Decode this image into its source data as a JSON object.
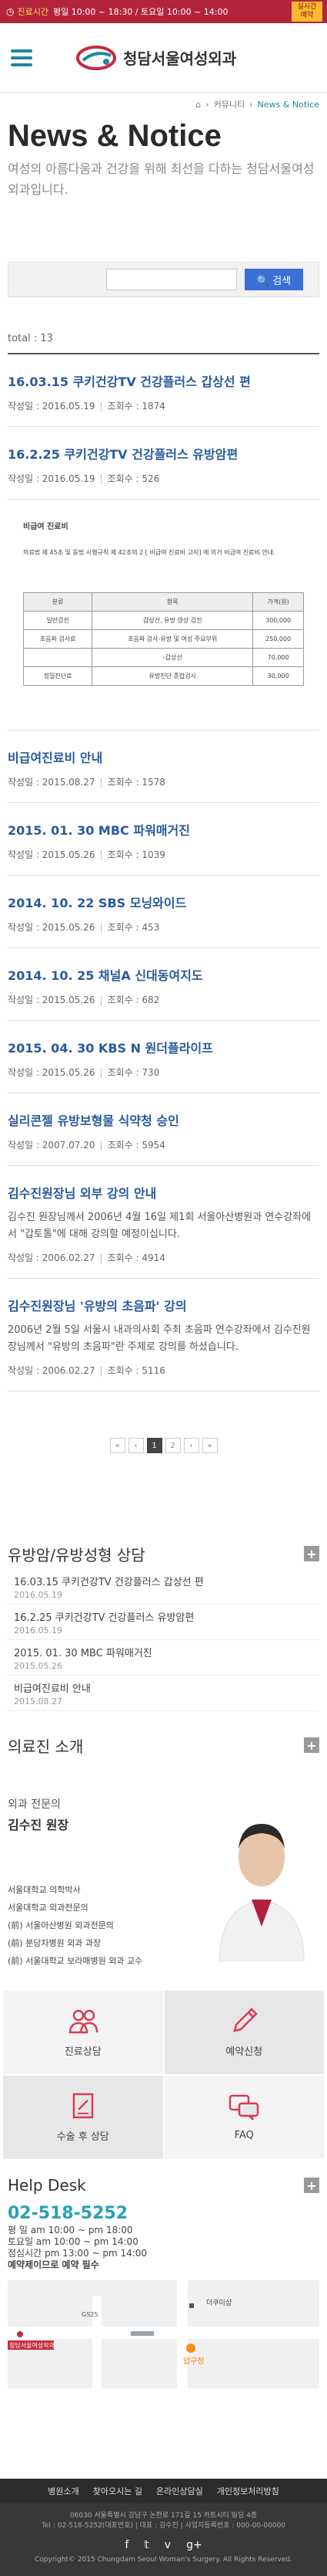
{
  "topbar": {
    "hours_label": "진료시간",
    "hours": "평일 10:00 ~ 18:30 / 토요일 10:00 ~ 14:00",
    "reserve_line1": "실시간",
    "reserve_line2": "예약"
  },
  "header": {
    "logo_text": "청담서울여성외과"
  },
  "breadcrumb": {
    "sep": "›",
    "parent": "커뮤니티",
    "current": "News & Notice"
  },
  "page": {
    "title": "News & Notice",
    "description": "여성의 아름다움과 건강을 위해 최선을 다하는 청담서울여성외과입니다."
  },
  "search": {
    "button": "🔍 검색",
    "placeholder": ""
  },
  "total": "total : 13",
  "meta_labels": {
    "date": "작성일",
    "views": "조회수"
  },
  "posts_top": [
    {
      "title": "16.03.15 쿠키건강TV 건강플러스 갑상선 편",
      "date": "2016.05.19",
      "views": "1874"
    },
    {
      "title": "16.2.25 쿠키건강TV 건강플러스 유방암편",
      "date": "2016.05.19",
      "views": "526"
    }
  ],
  "notice_block": {
    "title": "비급여 진료비",
    "intro": "의료법 제 45조 및 동법 시행규칙 제 42조의 2 [ 비급여 진료비 고지] 에 의거 비급여 진료비 안내.",
    "headers": [
      "분류",
      "항목",
      "가격(원)"
    ],
    "rows": [
      [
        "일반검진",
        "갑상선, 유방 영상 검진",
        "300,000"
      ],
      [
        "초음파 검사료",
        "초음파 검사-유방 및 여성 주요부위",
        "250,000"
      ],
      [
        "",
        "-갑상선",
        "70,000"
      ],
      [
        "정밀진단료",
        "유방진단 종합검사",
        "30,000"
      ]
    ]
  },
  "posts_bottom": [
    {
      "title": "비급여진료비 안내",
      "date": "2015.08.27",
      "views": "1578",
      "body": ""
    },
    {
      "title": "2015. 01. 30 MBC 파워매거진",
      "date": "2015.05.26",
      "views": "1039",
      "body": ""
    },
    {
      "title": "2014. 10. 22 SBS 모닝와이드",
      "date": "2015.05.26",
      "views": "453",
      "body": ""
    },
    {
      "title": "2014. 10. 25 채널A 신대동여지도",
      "date": "2015.05.26",
      "views": "682",
      "body": ""
    },
    {
      "title": "2015. 04. 30 KBS N 원더플라이프",
      "date": "2015.05.26",
      "views": "730",
      "body": ""
    },
    {
      "title": "실리콘젤 유방보형물 식약청 승인",
      "date": "2007.07.20",
      "views": "5954",
      "body": ""
    },
    {
      "title": "김수진원장님 외부 강의 안내",
      "date": "2006.02.27",
      "views": "4914",
      "body": "김수진 원장님께서 2006년 4월 16일 제1회 서울아산병원과 연수강좌에서 \"갑토톨\"에 대해 강의할 예정이십니다."
    },
    {
      "title": "김수진원장님 '유방의 초음파' 강의",
      "date": "2006.02.27",
      "views": "5116",
      "body": "2006년 2월 5일 서울시 내과의사회 주최 초음파 연수강좌에서 김수진원장님께서 \"유방의 초음파\"란 주제로 강의를 하셨습니다."
    }
  ],
  "pagination": {
    "first": "«",
    "prev": "‹",
    "pages": [
      "1",
      "2"
    ],
    "next": "›",
    "last": "»",
    "active": "1"
  },
  "side_news": {
    "title": "유방암/유방성형 상담",
    "items": [
      {
        "title": "16.03.15 쿠키건강TV 건강플러스 갑상선 편",
        "date": "2016.05.19"
      },
      {
        "title": "16.2.25 쿠키건강TV 건강플러스 유방암편",
        "date": "2016.05.19"
      },
      {
        "title": "2015. 01. 30 MBC 파워매거진",
        "date": "2015.05.26"
      },
      {
        "title": "비급여진료비 안내",
        "date": "2015.08.27"
      }
    ]
  },
  "doctor": {
    "section_title": "의료진 소개",
    "subtitle": "외과 전문의",
    "name": "김수진 원장",
    "career": [
      "서울대학교 의학박사",
      "서울대학교 외과전문의",
      "(前) 서울아산병원 외과전문의",
      "(前) 분당차병원 외과 과장",
      "(前) 서울대학교 보라매병원 외과 교수"
    ]
  },
  "quick_menu": [
    {
      "label": "진료상담",
      "icon": "people-icon"
    },
    {
      "label": "예약신청",
      "icon": "pencil-icon"
    },
    {
      "label": "수술 후 상담",
      "icon": "document-icon"
    },
    {
      "label": "FAQ",
      "icon": "chat-icon"
    }
  ],
  "helpdesk": {
    "title": "Help Desk",
    "phone": "02-518-5252",
    "weekday": "평 일 am 10:00 ~ pm 18:00",
    "saturday": "토요일 am 10:00 ~ pm 14:00",
    "lunch": "점심시간 pm 13:00 ~ pm 14:00",
    "note": "예약제이므로 예약 필수"
  },
  "map": {
    "label_station": "압구정",
    "label_building": "더쿠이샵",
    "label_hospital": "청담서울여성외과",
    "label_road": "GS25"
  },
  "footer": {
    "nav": [
      "병원소개",
      "찾아오시는 길",
      "온라인상담실",
      "개인정보처리방침"
    ],
    "address": "06030 서울특별시 강남구 논현로 171길 15 카트시티 빌딩 4층",
    "contact": "Tel : 02-518-5252(대표번호) | 대표 : 김수진 | 사업자등록번호 : 000-00-00000",
    "copyright": "Copyright© 2015 Chungdam Seoul Woman's Surgery. All Rights Reserved."
  },
  "colors": {
    "brand_red": "#b3243a",
    "teal": "#1e8a98",
    "link_blue": "#2a5a9a",
    "search_blue": "#3a6fd6",
    "reserve_yellow": "#ffb92e"
  }
}
